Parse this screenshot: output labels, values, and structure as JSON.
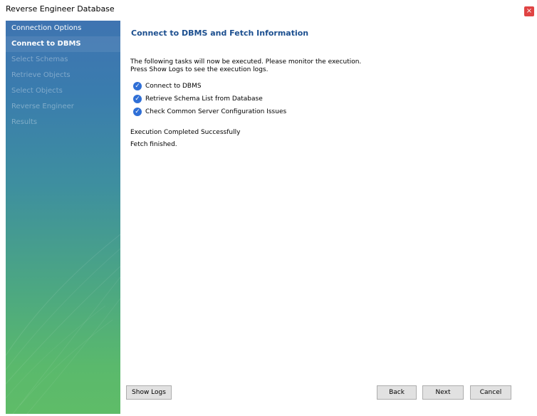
{
  "window": {
    "title": "Reverse Engineer Database",
    "close_glyph": "×"
  },
  "sidebar": {
    "items": [
      {
        "label": "Connection Options",
        "state": "done"
      },
      {
        "label": "Connect to DBMS",
        "state": "active"
      },
      {
        "label": "Select Schemas",
        "state": "pending"
      },
      {
        "label": "Retrieve Objects",
        "state": "pending"
      },
      {
        "label": "Select Objects",
        "state": "pending"
      },
      {
        "label": "Reverse Engineer",
        "state": "pending"
      },
      {
        "label": "Results",
        "state": "pending"
      }
    ]
  },
  "main": {
    "heading": "Connect to DBMS and Fetch Information",
    "intro_line1": "The following tasks will now be executed. Please monitor the execution.",
    "intro_line2": "Press Show Logs to see the execution logs.",
    "tasks": [
      {
        "label": "Connect to DBMS",
        "icon": "check-circle-icon"
      },
      {
        "label": "Retrieve Schema List from Database",
        "icon": "check-circle-icon"
      },
      {
        "label": "Check Common Server Configuration Issues",
        "icon": "check-circle-icon"
      }
    ],
    "status": "Execution Completed Successfully",
    "fetch_status": "Fetch finished."
  },
  "buttons": {
    "show_logs": "Show Logs",
    "back": "Back",
    "next": "Next",
    "cancel": "Cancel"
  },
  "colors": {
    "heading": "#1c4f8f",
    "check": "#2f6fd6",
    "close": "#e04343",
    "sidebar_top": "#3f74b1",
    "sidebar_bottom": "#5fbc68"
  }
}
